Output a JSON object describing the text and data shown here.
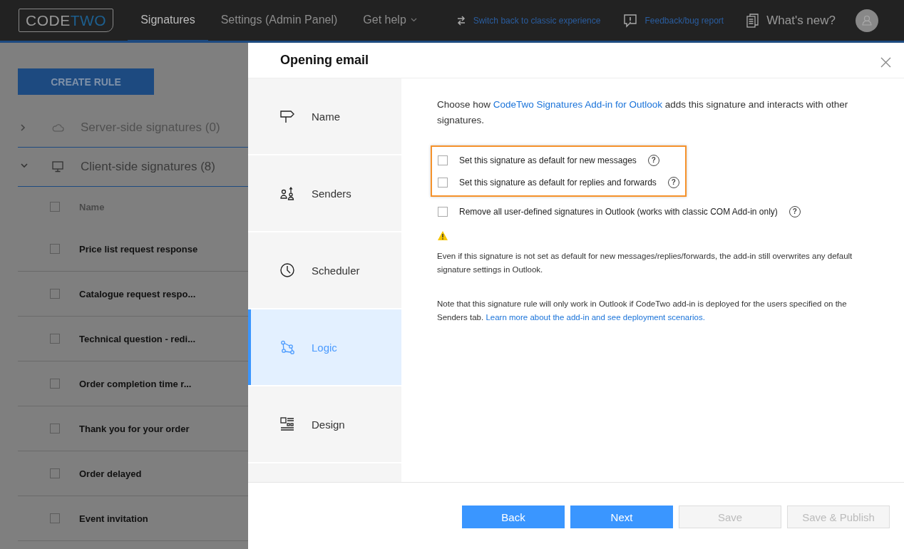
{
  "topbar": {
    "logo": {
      "part_1": "CODE",
      "part_2": "TWO"
    },
    "tabs": [
      {
        "label": "Signatures",
        "selected": true,
        "dropdown": false
      },
      {
        "label": "Settings (Admin Panel)",
        "selected": false,
        "dropdown": false
      },
      {
        "label": "Get help",
        "selected": false,
        "dropdown": true
      }
    ],
    "links": [
      {
        "kind": "switch",
        "label": "Switch back to classic experience"
      },
      {
        "kind": "feedback",
        "label": "Feedback/bug report"
      },
      {
        "kind": "news",
        "label": "What's new?"
      }
    ]
  },
  "background": {
    "create_button": "CREATE RULE",
    "groups": [
      {
        "kind": "cloud",
        "label": "Server-side signatures (0)",
        "expanded": false
      },
      {
        "kind": "computer",
        "label": "Client-side signatures (8)",
        "expanded": true
      }
    ],
    "table": {
      "columns": [
        {
          "label": "Name",
          "checked": false
        }
      ],
      "rows": [
        {
          "name": "Price list request response",
          "checked": false
        },
        {
          "name": "Catalogue request respo...",
          "checked": false
        },
        {
          "name": "Technical question - redi...",
          "checked": false
        },
        {
          "name": "Order completion time r...",
          "checked": false
        },
        {
          "name": "Thank you for your order",
          "checked": false
        },
        {
          "name": "Order delayed",
          "checked": false
        },
        {
          "name": "Event invitation",
          "checked": false
        }
      ]
    }
  },
  "dialog": {
    "title": "Opening email",
    "steps": [
      {
        "kind": "signpost",
        "label": "Name",
        "selected": false
      },
      {
        "kind": "senders",
        "label": "Senders",
        "selected": false
      },
      {
        "kind": "clock",
        "label": "Scheduler",
        "selected": false
      },
      {
        "kind": "logic",
        "label": "Logic",
        "selected": true
      },
      {
        "kind": "design",
        "label": "Design",
        "selected": false
      }
    ],
    "intro": {
      "before": "Choose how ",
      "link": "CodeTwo Signatures Add-in for Outlook",
      "after": " adds this signature and interacts with other signatures."
    },
    "option_groups": [
      {
        "highlighted": true,
        "options": [
          {
            "label": "Set this signature as default for new messages",
            "checked": false,
            "help": "?"
          },
          {
            "label": "Set this signature as default for replies and forwards",
            "checked": false,
            "help": "?"
          }
        ]
      },
      {
        "highlighted": false,
        "options": [
          {
            "label": "Remove all user-defined signatures in Outlook (works with classic COM Add-in only)",
            "checked": false,
            "help": "?"
          }
        ]
      }
    ],
    "warning": "Even if this signature is not set as default for new messages/replies/forwards, the add-in still overwrites any default signature settings in Outlook.",
    "note": {
      "before": "Note that this signature rule will only work in Outlook if CodeTwo add-in is deployed for the users specified on the Senders tab. ",
      "link": "Learn more about the add-in and see deployment scenarios."
    },
    "buttons": [
      {
        "label": "Back",
        "disabled": false
      },
      {
        "label": "Next",
        "disabled": false
      },
      {
        "label": "Save",
        "disabled": true
      },
      {
        "label": "Save & Publish",
        "disabled": true
      }
    ]
  }
}
